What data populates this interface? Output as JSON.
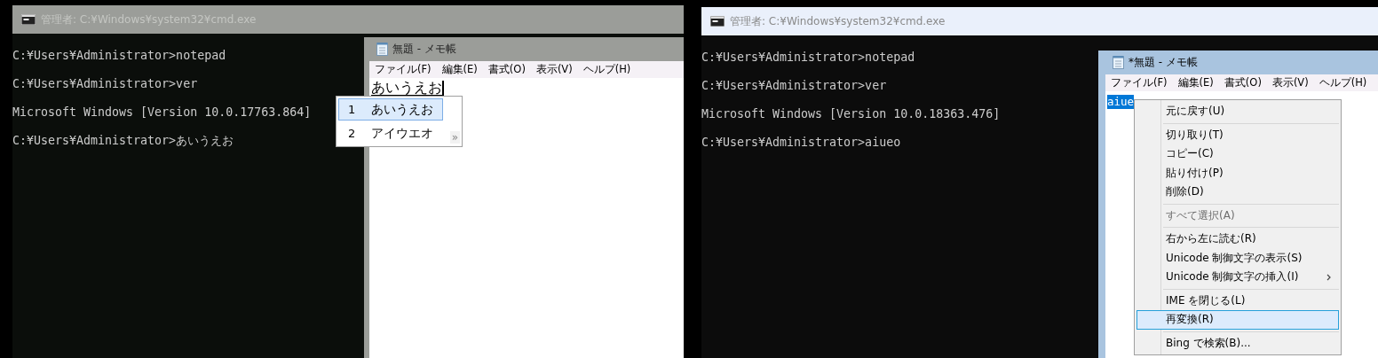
{
  "panels": [
    {
      "cmd": {
        "title": "管理者: C:¥Windows¥system32¥cmd.exe",
        "active": false,
        "lines": [
          "C:¥Users¥Administrator>notepad",
          "C:¥Users¥Administrator>ver",
          "Microsoft Windows [Version 10.0.17763.864]",
          "C:¥Users¥Administrator>あいうえお"
        ]
      },
      "notepad": {
        "title": "無題 - メモ帳",
        "active": false,
        "menu": [
          "ファイル(F)",
          "編集(E)",
          "書式(O)",
          "表示(V)",
          "ヘルプ(H)"
        ],
        "text": "あいうえお",
        "composing": true,
        "selected": false
      },
      "ime_candidates": {
        "items": [
          {
            "number": "1",
            "text": "あいうえお",
            "selected": true
          },
          {
            "number": "2",
            "text": "アイウエオ",
            "selected": false
          }
        ],
        "more": "»"
      }
    },
    {
      "cmd": {
        "title": "管理者: C:¥Windows¥system32¥cmd.exe",
        "active": true,
        "lines": [
          "C:¥Users¥Administrator>notepad",
          "C:¥Users¥Administrator>ver",
          "Microsoft Windows [Version 10.0.18363.476]",
          "C:¥Users¥Administrator>aiueo"
        ]
      },
      "notepad": {
        "title": "*無題 - メモ帳",
        "active": true,
        "menu": [
          "ファイル(F)",
          "編集(E)",
          "書式(O)",
          "表示(V)",
          "ヘルプ(H)"
        ],
        "text": "aiue",
        "composing": false,
        "selected": true
      },
      "context_menu": {
        "items": [
          {
            "kind": "item",
            "label": "元に戻す(U)",
            "disabled": false,
            "selected": false,
            "submenu": false
          },
          {
            "kind": "separator"
          },
          {
            "kind": "item",
            "label": "切り取り(T)",
            "disabled": false,
            "selected": false,
            "submenu": false
          },
          {
            "kind": "item",
            "label": "コピー(C)",
            "disabled": false,
            "selected": false,
            "submenu": false
          },
          {
            "kind": "item",
            "label": "貼り付け(P)",
            "disabled": false,
            "selected": false,
            "submenu": false
          },
          {
            "kind": "item",
            "label": "削除(D)",
            "disabled": false,
            "selected": false,
            "submenu": false
          },
          {
            "kind": "separator"
          },
          {
            "kind": "item",
            "label": "すべて選択(A)",
            "disabled": true,
            "selected": false,
            "submenu": false
          },
          {
            "kind": "separator"
          },
          {
            "kind": "item",
            "label": "右から左に読む(R)",
            "disabled": false,
            "selected": false,
            "submenu": false
          },
          {
            "kind": "item",
            "label": "Unicode 制御文字の表示(S)",
            "disabled": false,
            "selected": false,
            "submenu": false
          },
          {
            "kind": "item",
            "label": "Unicode 制御文字の挿入(I)",
            "disabled": false,
            "selected": false,
            "submenu": true
          },
          {
            "kind": "separator"
          },
          {
            "kind": "item",
            "label": "IME を閉じる(L)",
            "disabled": false,
            "selected": false,
            "submenu": false
          },
          {
            "kind": "item",
            "label": "再変換(R)",
            "disabled": false,
            "selected": true,
            "submenu": false
          },
          {
            "kind": "separator"
          },
          {
            "kind": "item",
            "label": "Bing で検索(B)...",
            "disabled": false,
            "selected": false,
            "submenu": false
          }
        ]
      }
    }
  ]
}
